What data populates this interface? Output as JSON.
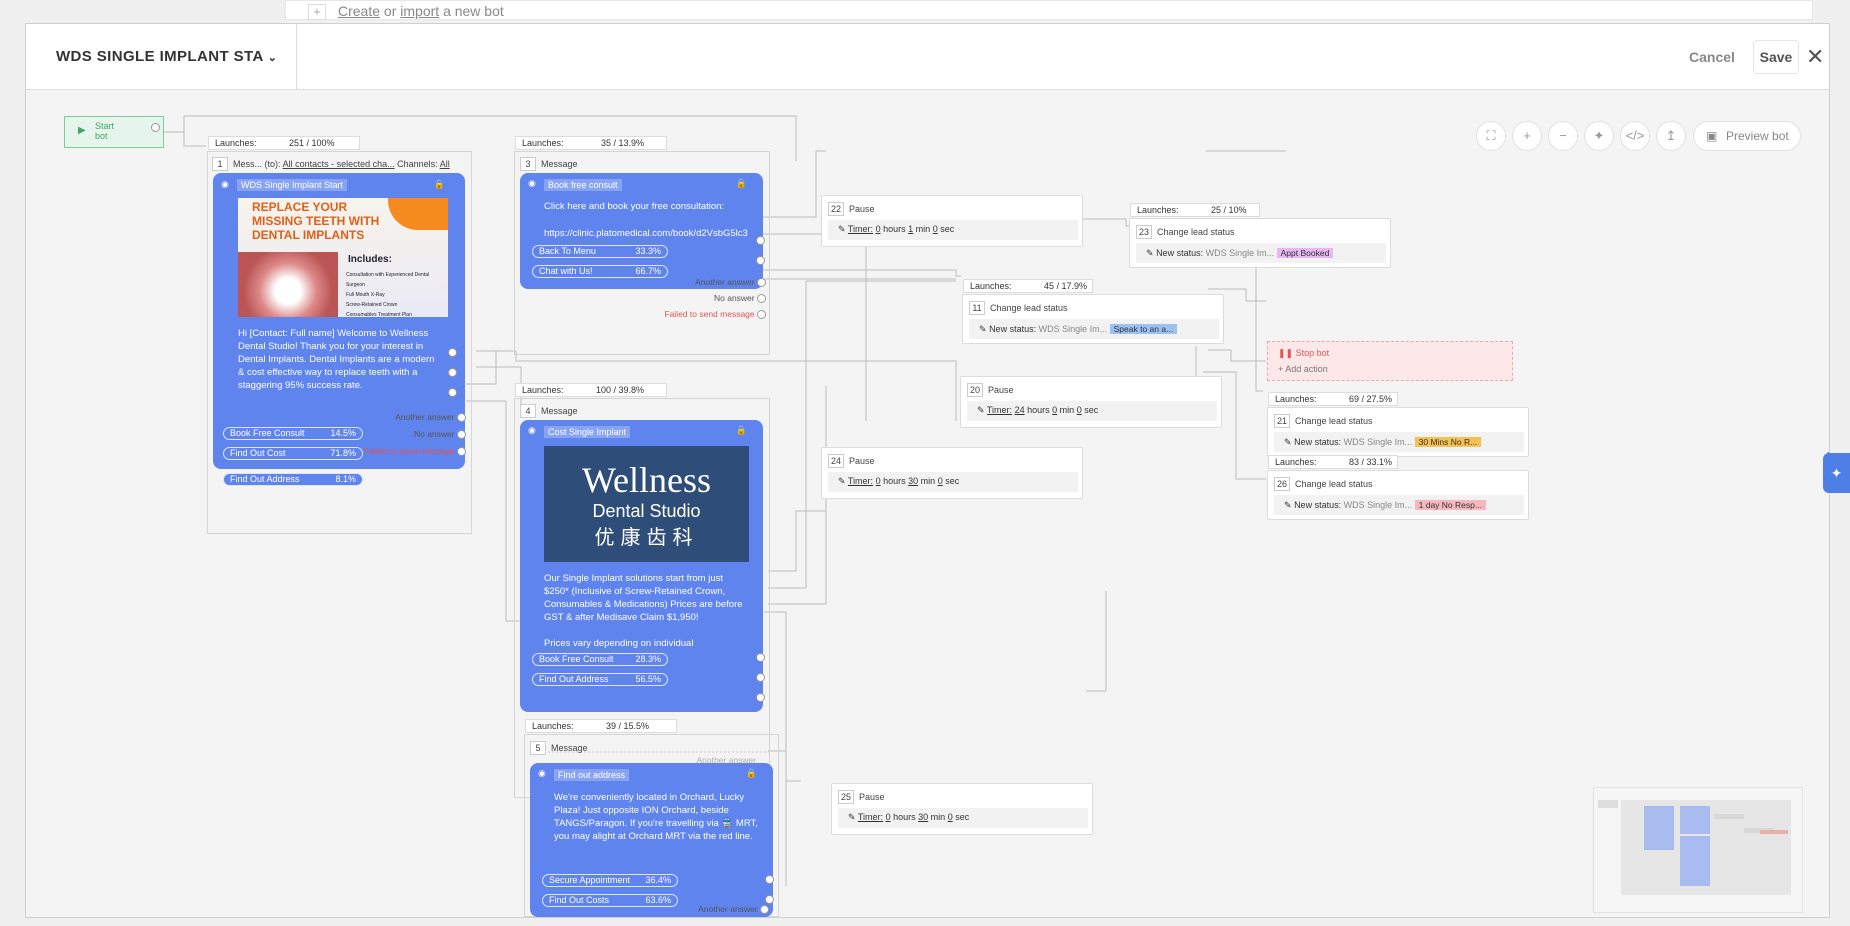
{
  "background": {
    "create": "Create",
    "or": "or",
    "import": "import",
    "rest": "a new bot"
  },
  "header": {
    "title": "WDS SINGLE IMPLANT STA",
    "cancel": "Cancel",
    "save": "Save"
  },
  "toolbar": {
    "preview": "Preview bot"
  },
  "start": {
    "label": "Start bot"
  },
  "n1": {
    "launches": "Launches:",
    "value": "251 / 100%",
    "num": "1",
    "type": "Mess...",
    "to": "(to):",
    "contacts": "All contacts - selected cha...",
    "channels": "Channels:",
    "all": "All",
    "title": "WDS Single Implant Start",
    "img": {
      "line1": "REPLACE YOUR",
      "line2": "MISSING TEETH WITH",
      "line3": "DENTAL IMPLANTS",
      "includes": "Includes:",
      "items": [
        "Consultation with Experienced Dental Surgeon",
        "Full Mouth X-Ray",
        "Screw-Retained Crown",
        "Consumables Treatment Plan"
      ]
    },
    "text": "Hi [Contact: Full name] Welcome to Wellness Dental Studio! Thank you for your interest in Dental Implants. Dental Implants are a modern & cost effective way to replace teeth with a staggering 95% success rate.",
    "buttons": [
      {
        "label": "Book Free Consult",
        "pct": "14.5%"
      },
      {
        "label": "Find Out Cost",
        "pct": "71.8%"
      },
      {
        "label": "Find Out Address",
        "pct": "8.1%"
      }
    ],
    "another": "Another answer",
    "noanswer": "No answer",
    "failed": "Failed to send message"
  },
  "n3": {
    "launches": "Launches:",
    "value": "35 / 13.9%",
    "num": "3",
    "type": "Message",
    "title": "Book free consult",
    "text": "Click here and book your free consultation:",
    "url": "https://clinic.platomedical.com/book/d2VsbG5lc3",
    "buttons": [
      {
        "label": "Back To Menu",
        "pct": "33.3%"
      },
      {
        "label": "Chat with Us!",
        "pct": "66.7%"
      }
    ],
    "another": "Another answer",
    "noanswer": "No answer",
    "failed": "Failed to send message"
  },
  "n4": {
    "launches": "Launches:",
    "value": "100 / 39.8%",
    "num": "4",
    "type": "Message",
    "title": "Cost Single Implant",
    "logo": {
      "big": "Wellness",
      "small": "Dental Studio",
      "cn": "优康齿科"
    },
    "text": "Our Single Implant solutions start from just $250* (Inclusive of Screw-Retained Crown, Consumables & Medications) Prices are before GST & after Medisave Claim $1,950!",
    "text2": "Prices vary depending on individual",
    "buttons": [
      {
        "label": "Book Free Consult",
        "pct": "28.3%"
      },
      {
        "label": "Find Out Address",
        "pct": "56.5%"
      }
    ],
    "another": "Another answer"
  },
  "n5": {
    "launches": "Launches:",
    "value": "39 / 15.5%",
    "num": "5",
    "type": "Message",
    "title": "Find out address",
    "text": "We're conveniently located in Orchard, Lucky Plaza! Just opposite ION Orchard, beside TANGS/Paragon. If you're travelling via 🚆 MRT, you may alight at Orchard MRT via the red line.",
    "buttons": [
      {
        "label": "Secure Appointment",
        "pct": "36.4%"
      },
      {
        "label": "Find Out Costs",
        "pct": "63.6%"
      }
    ],
    "another": "Another answer"
  },
  "p22": {
    "num": "22",
    "type": "Pause",
    "timer": "Timer:",
    "h": "0",
    "hours": "hours",
    "m": "1",
    "min": "min",
    "s": "0",
    "sec": "sec"
  },
  "p20": {
    "num": "20",
    "type": "Pause",
    "timer": "Timer:",
    "h": "24",
    "hours": "hours",
    "m": "0",
    "min": "min",
    "s": "0",
    "sec": "sec"
  },
  "p24": {
    "num": "24",
    "type": "Pause",
    "timer": "Timer:",
    "h": "0",
    "hours": "hours",
    "m": "30",
    "min": "min",
    "s": "0",
    "sec": "sec"
  },
  "p25": {
    "num": "25",
    "type": "Pause",
    "timer": "Timer:",
    "h": "0",
    "hours": "hours",
    "m": "30",
    "min": "min",
    "s": "0",
    "sec": "sec"
  },
  "c23": {
    "launches": "Launches:",
    "value": "25 / 10%",
    "num": "23",
    "type": "Change lead status",
    "label": "New status:",
    "pipeline": "WDS Single Im...",
    "status": "Appt Booked"
  },
  "c11": {
    "launches": "Launches:",
    "value": "45 / 17.9%",
    "num": "11",
    "type": "Change lead status",
    "label": "New status:",
    "pipeline": "WDS Single Im...",
    "status": "Speak to an a..."
  },
  "c21": {
    "launches": "Launches:",
    "value": "69 / 27.5%",
    "num": "21",
    "type": "Change lead status",
    "label": "New status:",
    "pipeline": "WDS Single Im...",
    "status": "30 Mins No R..."
  },
  "c26": {
    "launches": "Launches:",
    "value": "83 / 33.1%",
    "num": "26",
    "type": "Change lead status",
    "label": "New status:",
    "pipeline": "WDS Single Im...",
    "status": "1 day No Resp..."
  },
  "stop": {
    "title": "Stop bot",
    "add": "Add action"
  },
  "colors": {
    "card": "#5f84ee",
    "accent": "#4e7fe6",
    "green": "#3fa766",
    "red": "#e05555"
  }
}
